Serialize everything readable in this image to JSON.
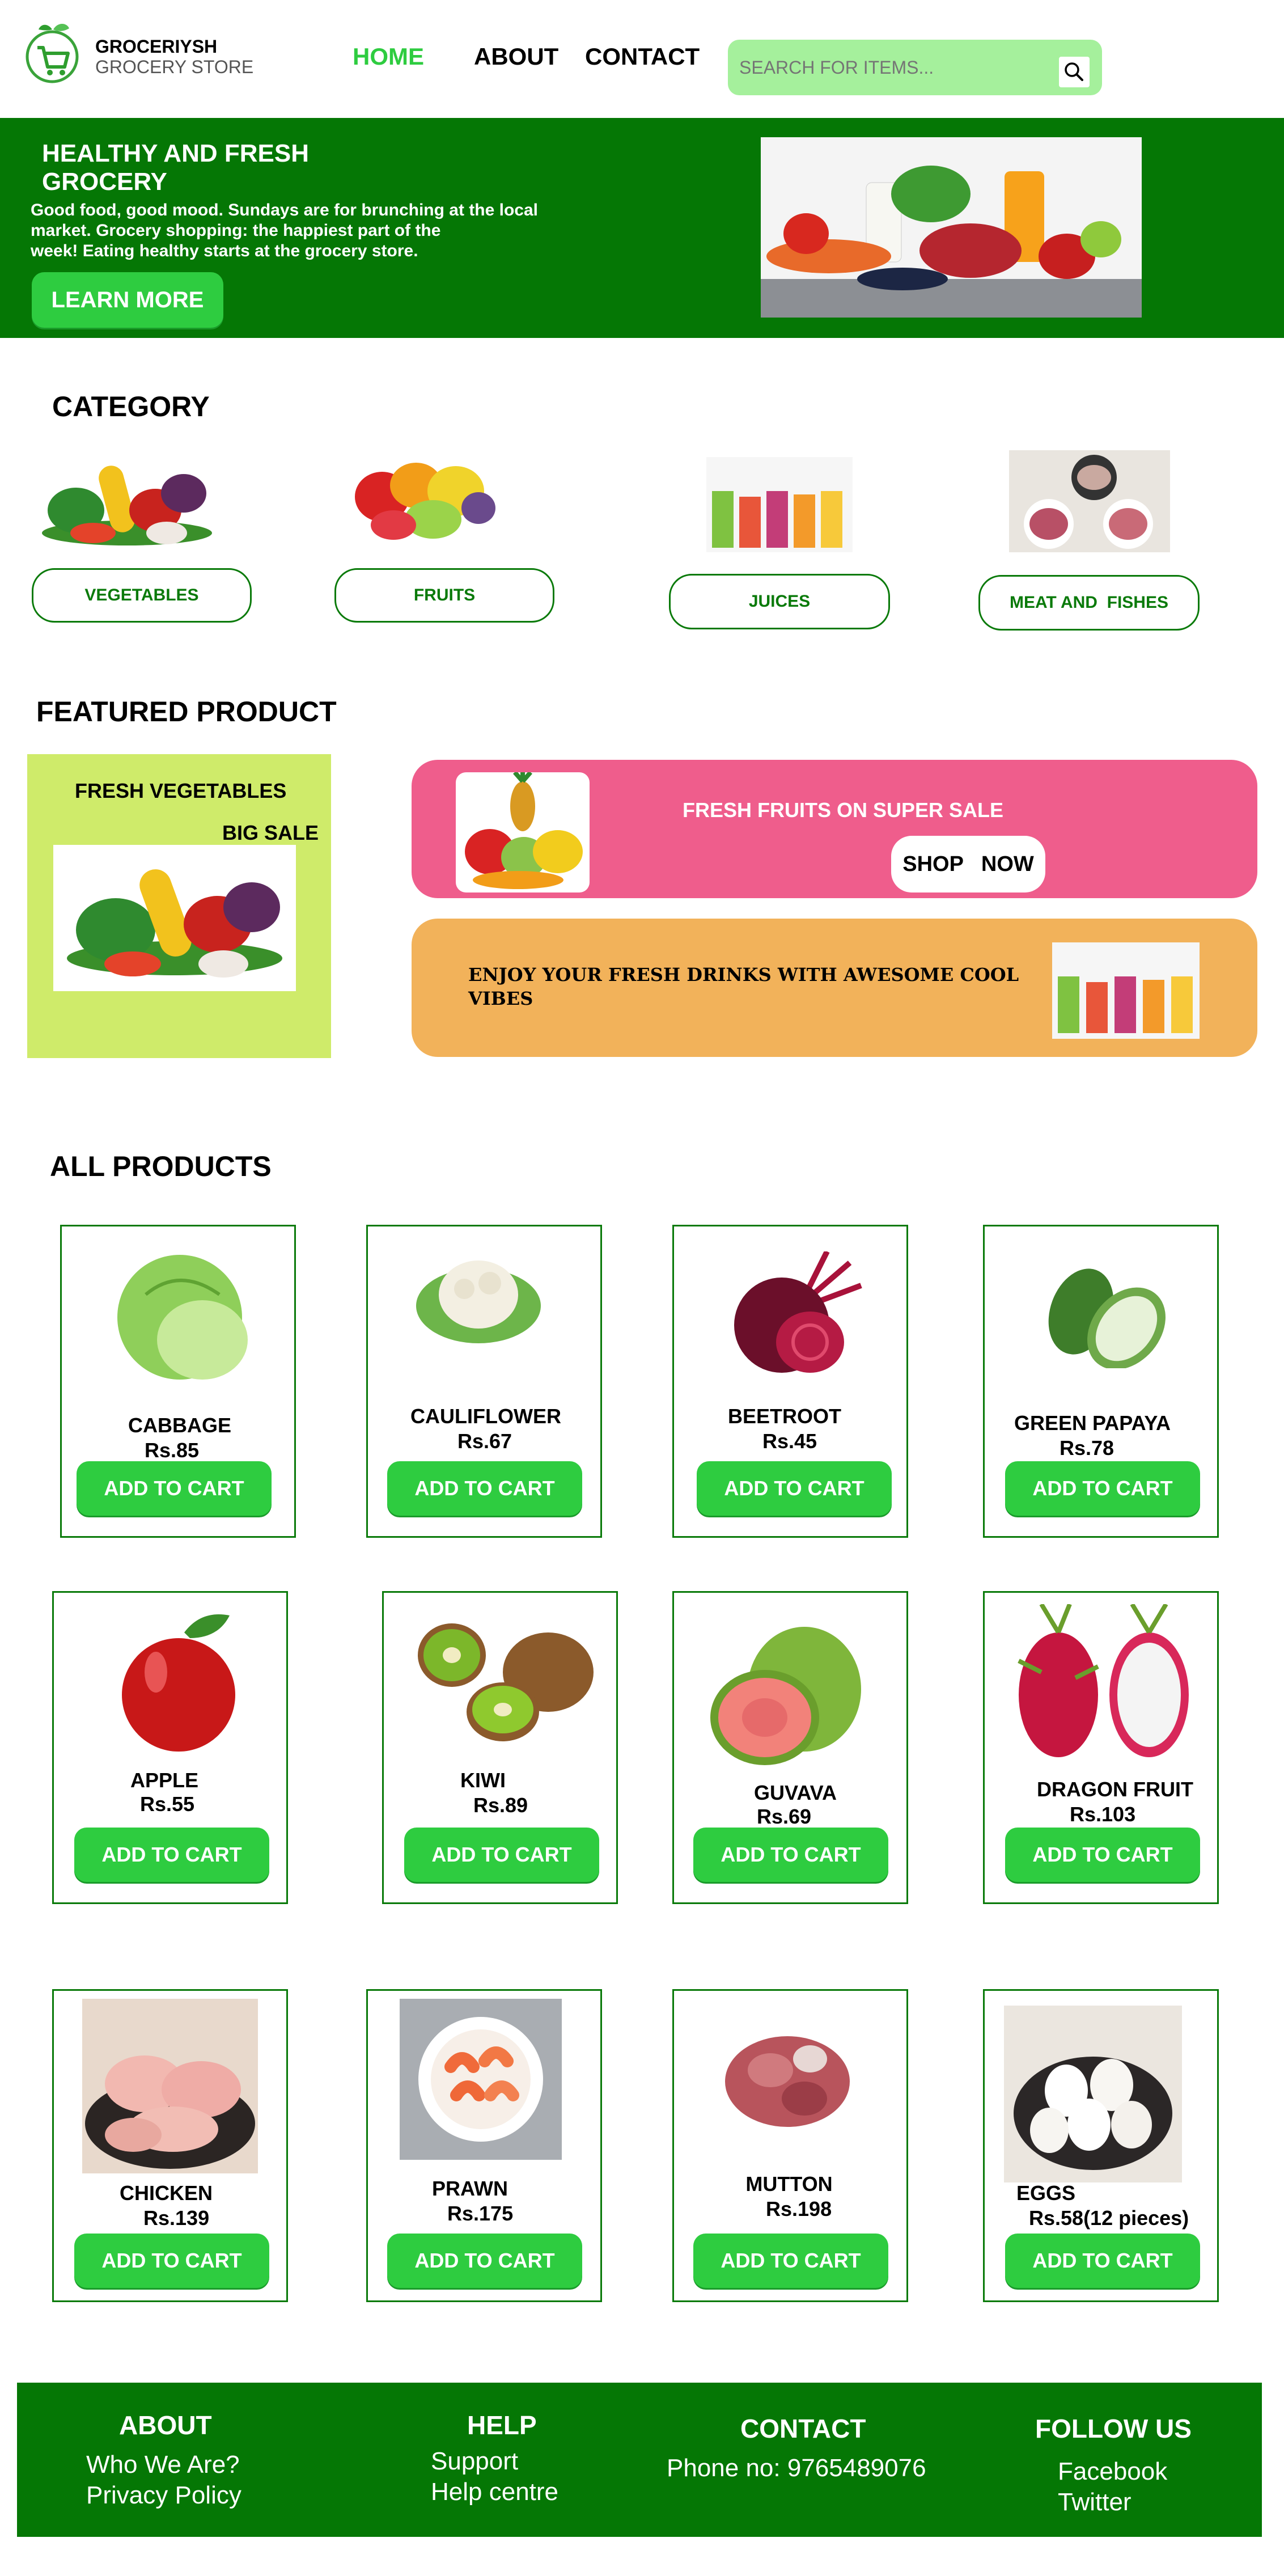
{
  "brand": {
    "name": "GROCERIYSH",
    "tagline": "GROCERY STORE"
  },
  "nav": {
    "home": "HOME",
    "about": "ABOUT",
    "contact": "CONTACT"
  },
  "search": {
    "placeholder": "SEARCH FOR ITEMS..."
  },
  "hero": {
    "title_line1": "HEALTHY AND FRESH",
    "title_line2": "GROCERY",
    "text_line1": "Good food, good mood. Sundays are for brunching at the local",
    "text_line2": "market. Grocery shopping: the happiest part of the",
    "text_line3": "week! Eating healthy starts at the grocery store.",
    "button": "LEARN MORE"
  },
  "category": {
    "title": "CATEGORY",
    "items": [
      {
        "label": "VEGETABLES"
      },
      {
        "label": "FRUITS"
      },
      {
        "label": "JUICES"
      },
      {
        "label": "MEAT AND  FISHES"
      }
    ]
  },
  "featured": {
    "title": "FEATURED PRODUCT",
    "veg_title": "FRESH VEGETABLES",
    "veg_sale": "BIG SALE",
    "fruits_title": "FRESH FRUITS ON SUPER SALE",
    "shop_now": "SHOP   NOW",
    "drinks_line1": "ENJOY YOUR FRESH DRINKS WITH AWESOME COOL",
    "drinks_line2": "VIBES"
  },
  "products": {
    "title": "ALL PRODUCTS",
    "add_to_cart": "ADD TO CART",
    "items": [
      {
        "name": "CABBAGE",
        "price": "Rs.85"
      },
      {
        "name": "CAULIFLOWER",
        "price": "Rs.67"
      },
      {
        "name": "BEETROOT",
        "price": "Rs.45"
      },
      {
        "name": "GREEN PAPAYA",
        "price": "Rs.78"
      },
      {
        "name": "APPLE",
        "price": "Rs.55"
      },
      {
        "name": "KIWI",
        "price": "Rs.89"
      },
      {
        "name": "GUVAVA",
        "price": "Rs.69"
      },
      {
        "name": "DRAGON FRUIT",
        "price": "Rs.103"
      },
      {
        "name": "CHICKEN",
        "price": "Rs.139"
      },
      {
        "name": "PRAWN",
        "price": "Rs.175"
      },
      {
        "name": "MUTTON",
        "price": "Rs.198"
      },
      {
        "name": "EGGS",
        "price": "Rs.58(12 pieces)"
      }
    ]
  },
  "footer": {
    "about": {
      "title": "ABOUT",
      "links": [
        "Who We Are?",
        "Privacy Policy"
      ]
    },
    "help": {
      "title": "HELP",
      "links": [
        "Support",
        "Help centre"
      ]
    },
    "contact": {
      "title": "CONTACT",
      "phone": "Phone no: 9765489076"
    },
    "follow": {
      "title": "FOLLOW US",
      "links": [
        "Facebook",
        "Twitter"
      ]
    }
  },
  "colors": {
    "dark_green": "#057705",
    "bright_green": "#2ecc40",
    "search_bg": "#a5f09c",
    "pink": "#ef5d8c",
    "orange": "#f2b25a",
    "lime": "#cfeb6a"
  }
}
